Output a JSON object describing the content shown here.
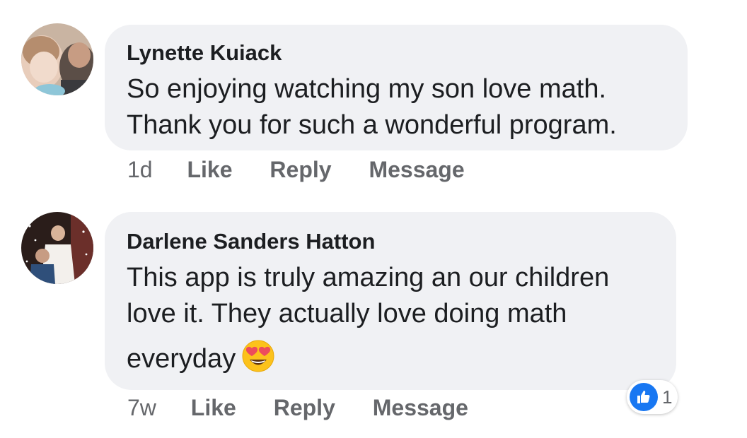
{
  "comments": [
    {
      "author": "Lynette Kuiack",
      "text_lines": [
        "So enjoying watching my son love math.",
        "Thank you for such a wonderful program."
      ],
      "time": "1d",
      "actions": [
        "Like",
        "Reply",
        "Message"
      ],
      "avatar_icon": "profile-photo"
    },
    {
      "author": "Darlene Sanders Hatton",
      "text_lines": [
        "This app is truly amazing an our children",
        "love it. They actually love doing math",
        "everyday"
      ],
      "emoji": "heart-eyes-emoji",
      "time": "7w",
      "actions": [
        "Like",
        "Reply",
        "Message"
      ],
      "avatar_icon": "profile-photo",
      "reaction": {
        "icon": "thumbs-up-icon",
        "count": "1"
      }
    }
  ],
  "colors": {
    "bubble": "#f0f1f4",
    "meta_text": "#65676b",
    "like_blue": "#1877f2"
  }
}
